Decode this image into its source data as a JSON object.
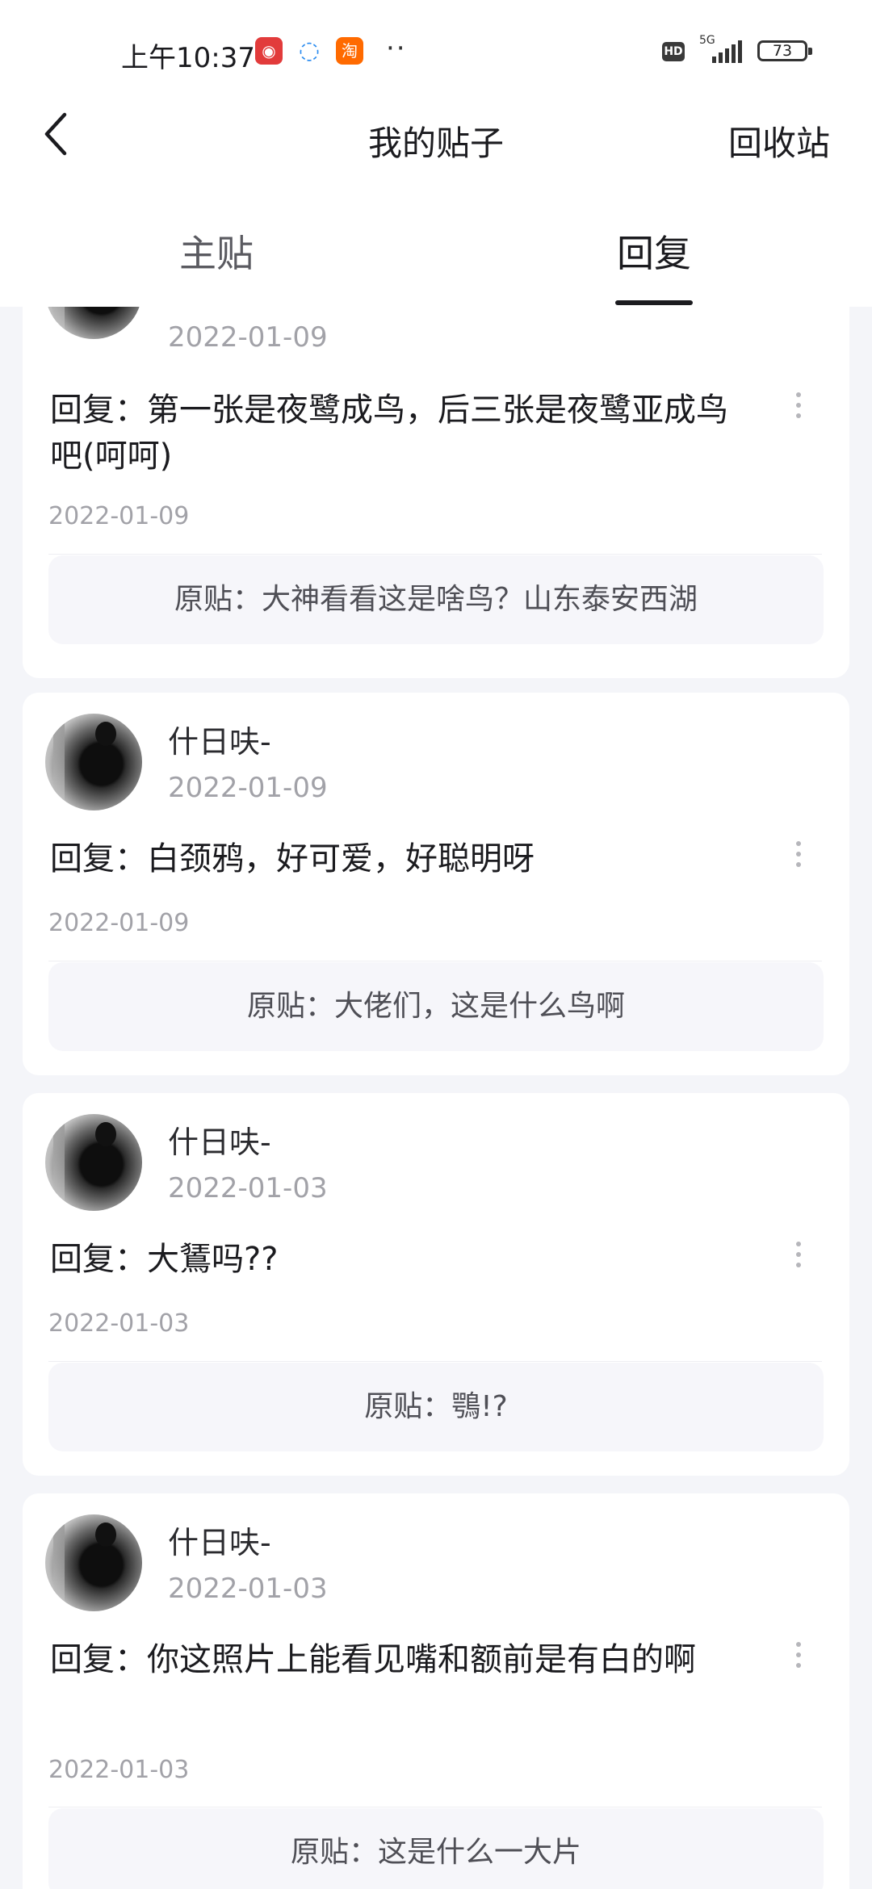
{
  "status_bar": {
    "time": "上午10:37",
    "apps": [
      "netease-music-icon",
      "browser-icon",
      "taobao-icon"
    ],
    "taobao_label": "淘",
    "more": "··",
    "hd": "HD",
    "network": "5G",
    "battery": "73"
  },
  "header": {
    "title": "我的贴子",
    "right_action": "回收站"
  },
  "tabs": [
    {
      "label": "主贴",
      "active": false
    },
    {
      "label": "回复",
      "active": true
    }
  ],
  "posts": [
    {
      "author": "",
      "time": "2022-01-09",
      "reply": "回复：第一张是夜鹭成鸟，后三张是夜鹭亚成鸟吧(呵呵)",
      "reply_time": "2022-01-09",
      "original": "原贴：大神看看这是啥鸟？山东泰安西湖"
    },
    {
      "author": "什日呋-",
      "time": "2022-01-09",
      "reply": "回复：白颈鸦，好可爱，好聪明呀",
      "reply_time": "2022-01-09",
      "original": "原贴：大佬们，这是什么鸟啊"
    },
    {
      "author": "什日呋-",
      "time": "2022-01-03",
      "reply": "回复：大鵟吗??",
      "reply_time": "2022-01-03",
      "original": "原贴：鶚!?"
    },
    {
      "author": "什日呋-",
      "time": "2022-01-03",
      "reply": "回复：你这照片上能看见嘴和额前是有白的啊",
      "reply_time": "2022-01-03",
      "original": "原贴：这是什么一大片"
    }
  ],
  "colors": {
    "background": "#f4f5f9",
    "card": "#ffffff",
    "original_bg": "#f6f6fa",
    "muted_text": "#a2a2a8"
  }
}
